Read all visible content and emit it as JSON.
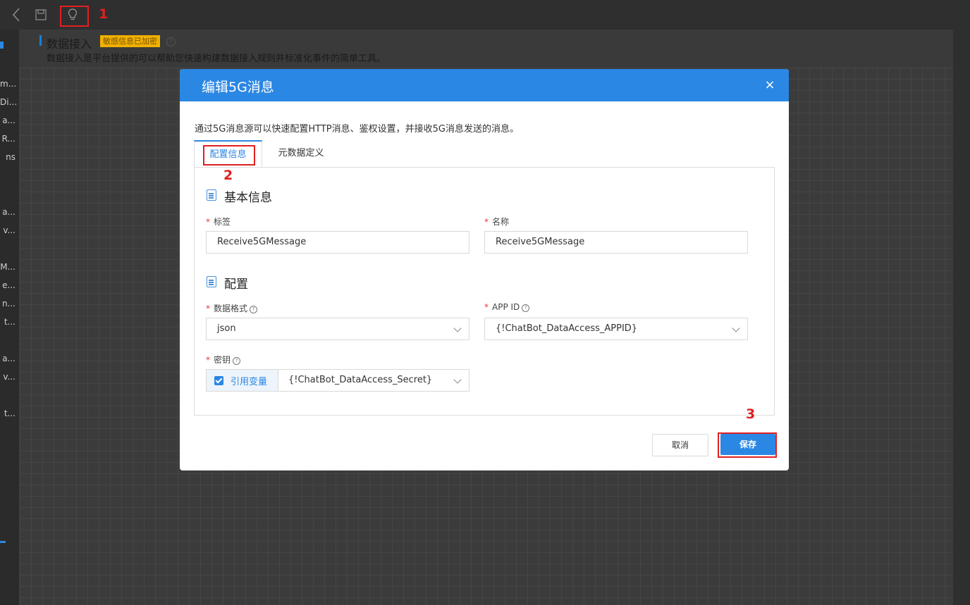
{
  "sidebar": {
    "items": [
      "m...",
      "Di...",
      "a...",
      "R...",
      "ns",
      "a...",
      "v...",
      "M...",
      "e...",
      "n...",
      "t...",
      "a...",
      "v...",
      "t..."
    ]
  },
  "page_header": {
    "title": "数据接入",
    "badge": "敏感信息已加密",
    "help": "?",
    "description": "数据接入是平台提供的可以帮助您快速构建数据接入规则并标准化事件的简单工具。"
  },
  "modal": {
    "title": "编辑5G消息",
    "close": "×",
    "description": "通过5G消息源可以快速配置HTTP消息、鉴权设置，并接收5G消息发送的消息。",
    "tabs": [
      "配置信息",
      "元数据定义"
    ],
    "sections": {
      "basic": "基本信息",
      "config": "配置"
    },
    "fields": {
      "tag": {
        "label": "标签",
        "value": "Receive5GMessage"
      },
      "name": {
        "label": "名称",
        "value": "Receive5GMessage"
      },
      "data_format": {
        "label": "数据格式",
        "value": "json"
      },
      "app_id": {
        "label": "APP ID",
        "value": "{!ChatBot_DataAccess_APPID}"
      },
      "secret": {
        "label": "密钥",
        "ref_label": "引用变量",
        "value": "{!ChatBot_DataAccess_Secret}"
      }
    },
    "required_mark": "*",
    "help_mark": "?",
    "buttons": {
      "cancel": "取消",
      "save": "保存"
    }
  },
  "annotations": [
    "1",
    "2",
    "3"
  ],
  "colors": {
    "accent": "#2b87e4",
    "annotation": "#e02020",
    "badge": "#f0b100"
  }
}
